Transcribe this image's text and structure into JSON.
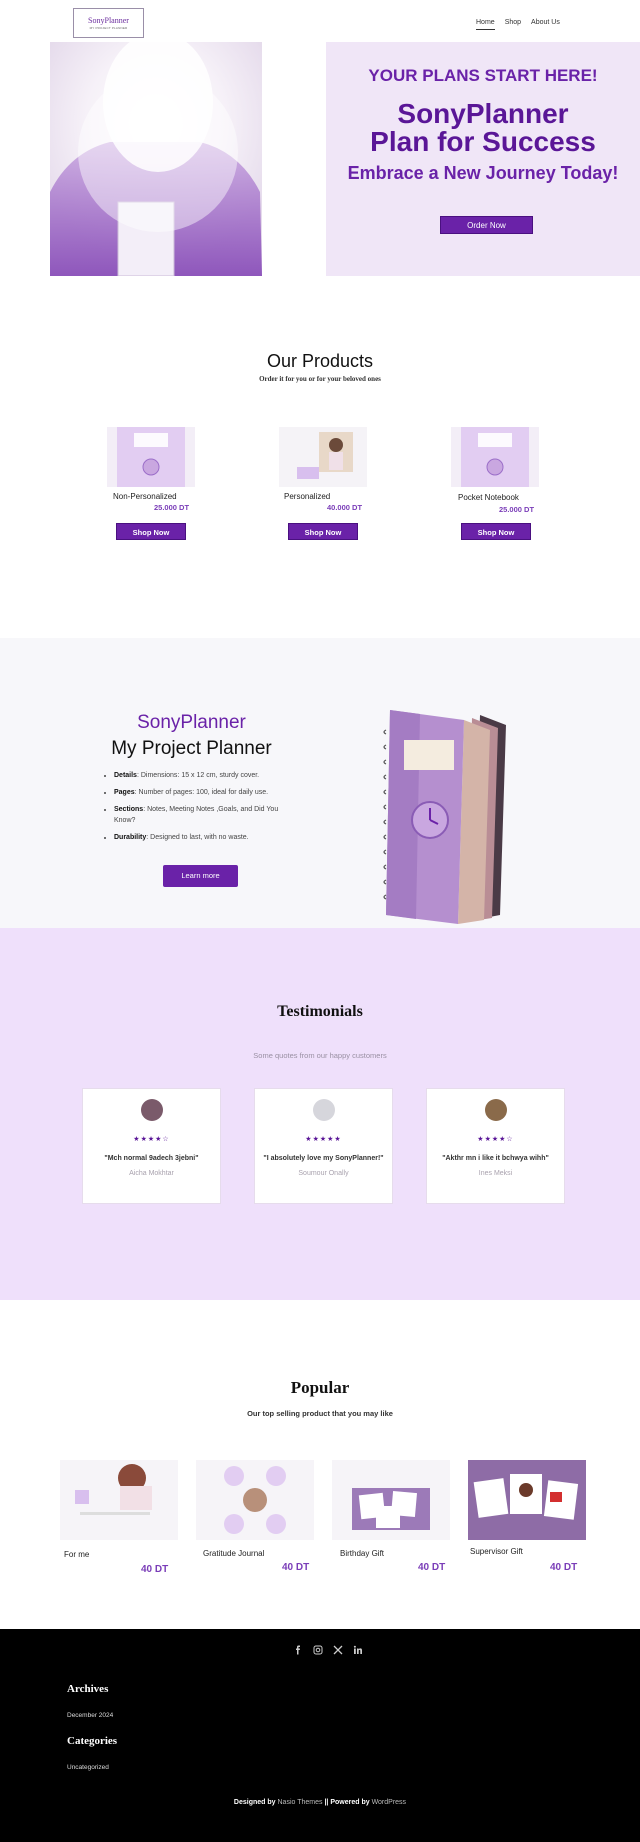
{
  "header": {
    "logo_name": "SonyPlanner",
    "logo_tagline": "MY PROJECT PLANNER",
    "nav": [
      "Home",
      "Shop",
      "About Us"
    ]
  },
  "hero": {
    "kicker": "YOUR PLANS START HERE!",
    "title_line1": "SonyPlanner",
    "title_line2": "Plan for Success",
    "subtitle": "Embrace a New Journey Today!",
    "button": "Order Now"
  },
  "products": {
    "title": "Our Products",
    "subtitle": "Order it for you or for your beloved ones",
    "items": [
      {
        "name": "Non-Personalized",
        "price": "25.000 DT",
        "button": "Shop Now"
      },
      {
        "name": "Personalized",
        "price": "40.000 DT",
        "button": "Shop Now"
      },
      {
        "name": "Pocket Notebook",
        "price": "25.000 DT",
        "button": "Shop Now"
      }
    ]
  },
  "planner": {
    "brand": "SonyPlanner",
    "title": "My Project Planner",
    "features": [
      {
        "label": "Details",
        "text": ": Dimensions: 15 x 12 cm, sturdy cover."
      },
      {
        "label": "Pages",
        "text": ": Number of pages: 100, ideal for daily use."
      },
      {
        "label": "Sections",
        "text": ": Notes, Meeting Notes ,Goals, and Did You Know?"
      },
      {
        "label": "Durability",
        "text": ": Designed to last, with no waste."
      }
    ],
    "button": "Learn more"
  },
  "testimonials": {
    "title": "Testimonials",
    "subtitle": "Some quotes from our happy customers",
    "items": [
      {
        "quote": "\"Mch normal 9adech 3jebni\"",
        "author": "Aicha Mokhtar",
        "stars": "★★★★☆"
      },
      {
        "quote": "\"I absolutely love my SonyPlanner!\"",
        "author": "Soumour Onally",
        "stars": "★★★★★"
      },
      {
        "quote": "\"Akthr mn i like it bchwya wihh\"",
        "author": "Ines Meksi",
        "stars": "★★★★☆"
      }
    ]
  },
  "popular": {
    "title": "Popular",
    "subtitle": "Our top selling product that you may like",
    "items": [
      {
        "name": "For me",
        "price": "40  DT"
      },
      {
        "name": "Gratitude Journal",
        "price": "40 DT"
      },
      {
        "name": "Birthday Gift",
        "price": "40 DT"
      },
      {
        "name": "Supervisor Gift",
        "price": "40 DT"
      }
    ]
  },
  "footer": {
    "archives_title": "Archives",
    "archives_item": "December 2024",
    "categories_title": "Categories",
    "categories_item": "Uncategorized",
    "credit_prefix": "Designed by ",
    "credit_theme": "Nasio Themes",
    "credit_mid": " || Powered by ",
    "credit_wp": "WordPress"
  },
  "colors": {
    "accent": "#6a22a8",
    "hero_panel": "#f0e6f7",
    "testimonials_bg": "#efe0fb",
    "footer_bg": "#000000"
  }
}
